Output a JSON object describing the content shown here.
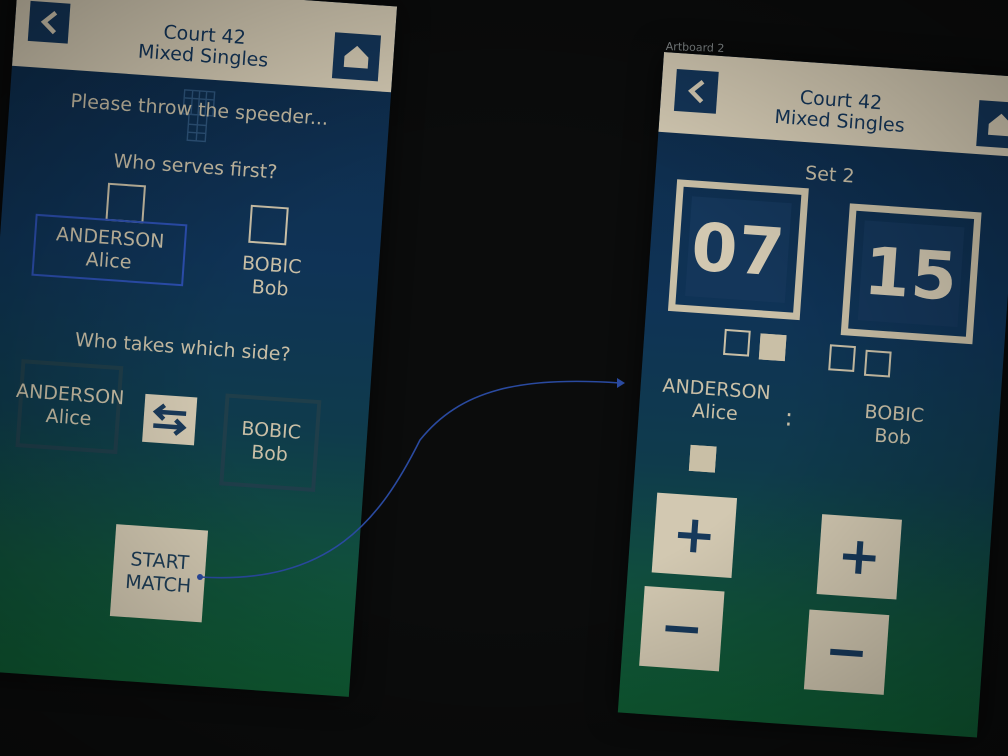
{
  "artboard_label": "Artboard 2",
  "setup_screen": {
    "header": {
      "line1": "Court 42",
      "line2": "Mixed Singles"
    },
    "instruction": "Please throw the speeder...",
    "serve_question": "Who serves first?",
    "players": [
      {
        "surname": "ANDERSON",
        "first": "Alice"
      },
      {
        "surname": "BOBIC",
        "first": "Bob"
      }
    ],
    "side_question": "Who takes which side?",
    "start_button": {
      "line1": "START",
      "line2": "MATCH"
    }
  },
  "score_screen": {
    "header": {
      "line1": "Court 42",
      "line2": "Mixed Singles"
    },
    "set_label": "Set 2",
    "separator": ":",
    "players": [
      {
        "surname": "ANDERSON",
        "first": "Alice",
        "score": "07"
      },
      {
        "surname": "BOBIC",
        "first": "Bob",
        "score": "15"
      }
    ],
    "plus_label": "+",
    "minus_label": "−"
  },
  "colors": {
    "header_bg": "#d6ccb5",
    "navy": "#14365a",
    "cream_text": "#c9bfa6",
    "connector": "#2a4aa0"
  }
}
